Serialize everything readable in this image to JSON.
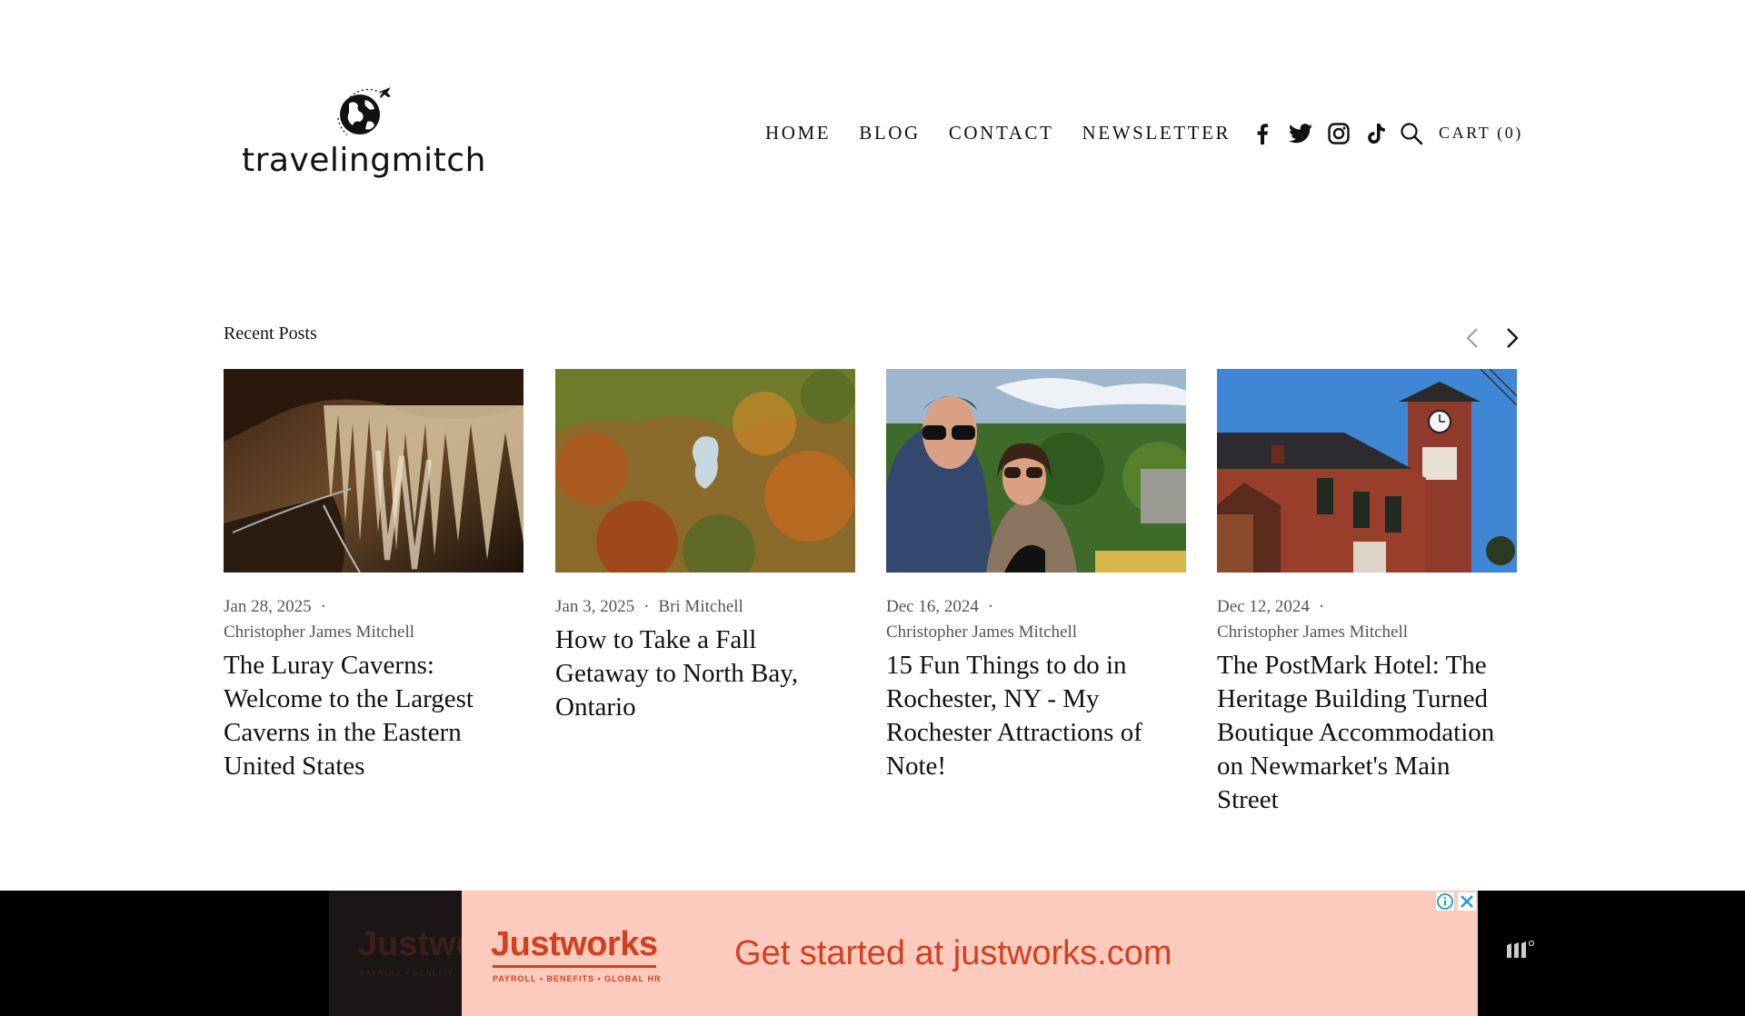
{
  "header": {
    "logo_text": "travelingmitch",
    "nav": [
      "HOME",
      "BLOG",
      "CONTACT",
      "NEWSLETTER"
    ],
    "social_icons": [
      "facebook-icon",
      "twitter-icon",
      "instagram-icon",
      "tiktok-icon"
    ],
    "search_icon": "search-icon",
    "cart_label": "CART (0)"
  },
  "recent_posts": {
    "title": "Recent Posts",
    "posts": [
      {
        "date": "Jan 28, 2025",
        "author": "Christopher James Mitchell",
        "title": "The Luray Caverns: Welcome to the Largest Caverns in the Eastern United States"
      },
      {
        "date": "Jan 3, 2025",
        "author": "Bri Mitchell",
        "title": "How to Take a Fall Getaway to North Bay, Ontario"
      },
      {
        "date": "Dec 16, 2024",
        "author": "Christopher James Mitchell",
        "title": "15 Fun Things to do in Rochester, NY - My Rochester Attractions of Note!"
      },
      {
        "date": "Dec 12, 2024",
        "author": "Christopher James Mitchell",
        "title": "The PostMark Hotel: The Heritage Building Turned Boutique Accommodation on Newmarket's Main Street"
      }
    ]
  },
  "ad": {
    "brand": "Justworks",
    "brand_ghost": "Justwo",
    "sub": "PAYROLL • BENEFITS • GLOBAL HR",
    "sub_ghost": "PAYROLL • BENEFIT",
    "cta": "Get started at justworks.com",
    "brand_color": "#d33f1f",
    "background_color": "#fccbbd"
  },
  "colors": {
    "text": "#111111",
    "meta": "#555555",
    "ad_bar": "#000000"
  }
}
